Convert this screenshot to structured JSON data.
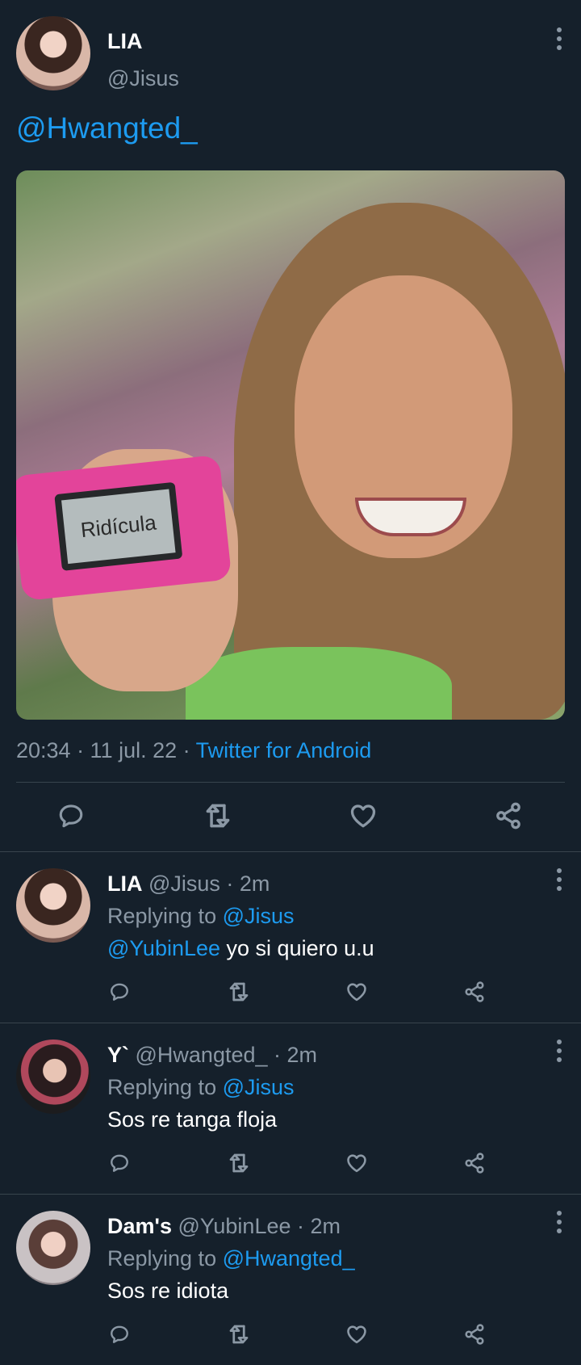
{
  "main_tweet": {
    "display_name": "LIA",
    "handle": "@Jisus",
    "text_mention": "@Hwangted_",
    "image_caption_text": "Ridícula",
    "timestamp": "20:34 · 11 jul. 22 · ",
    "source": "Twitter for Android"
  },
  "replies": [
    {
      "display_name": "LIA",
      "meta": " @Jisus · 2m",
      "replying_label": "Replying to ",
      "replying_to": "@Jisus",
      "mention": "@YubinLee",
      "text": " yo si quiero u.u"
    },
    {
      "display_name": "Y`",
      "meta": " @Hwangted_ · 2m",
      "replying_label": "Replying to ",
      "replying_to": "@Jisus",
      "mention": "",
      "text": "Sos re tanga floja"
    },
    {
      "display_name": "Dam's",
      "meta": " @YubinLee · 2m",
      "replying_label": "Replying to ",
      "replying_to": "@Hwangted_",
      "mention": "",
      "text": "Sos re idiota"
    }
  ],
  "colors": {
    "background": "#15202b",
    "accent": "#1d9bf0",
    "muted": "#8b98a5",
    "divider": "#38444d"
  },
  "icons": [
    "more-icon",
    "reply-icon",
    "retweet-icon",
    "like-icon",
    "share-icon"
  ]
}
